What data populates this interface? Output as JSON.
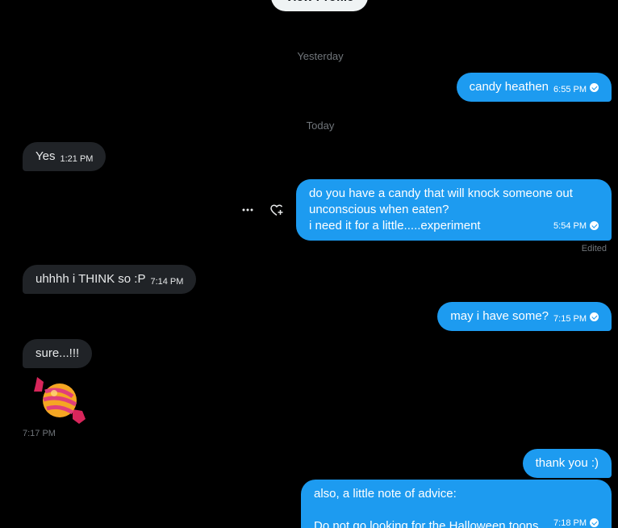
{
  "view_profile_label": "View Profile",
  "days": {
    "yesterday": "Yesterday",
    "today": "Today"
  },
  "messages": [
    {
      "text": "candy heathen",
      "time": "6:55 PM"
    },
    {
      "text": "Yes",
      "time": "1:21 PM"
    },
    {
      "lines": [
        "do you have a candy that will knock someone out",
        "unconscious when eaten?",
        "i need it for a little.....experiment"
      ],
      "time": "5:54 PM",
      "edited": "Edited"
    },
    {
      "text": "uhhhh i THINK so :P",
      "time": "7:14 PM"
    },
    {
      "text": "may i have some?",
      "time": "7:15 PM"
    },
    {
      "text": "sure...!!!"
    },
    {
      "sticker": "candy-sticker",
      "time": "7:17 PM"
    },
    {
      "text": "thank you :)"
    },
    {
      "lines": [
        "also, a little note of advice:",
        "",
        "Do not go looking for the Halloween toons."
      ],
      "time": "7:18 PM"
    }
  ],
  "icons": {
    "more": "more-icon",
    "react": "heart-add-icon",
    "read": "read-check-icon"
  },
  "colors": {
    "outgoing": "#1d9bf0",
    "incoming": "#202327",
    "background": "#000000",
    "muted": "#71767b"
  }
}
